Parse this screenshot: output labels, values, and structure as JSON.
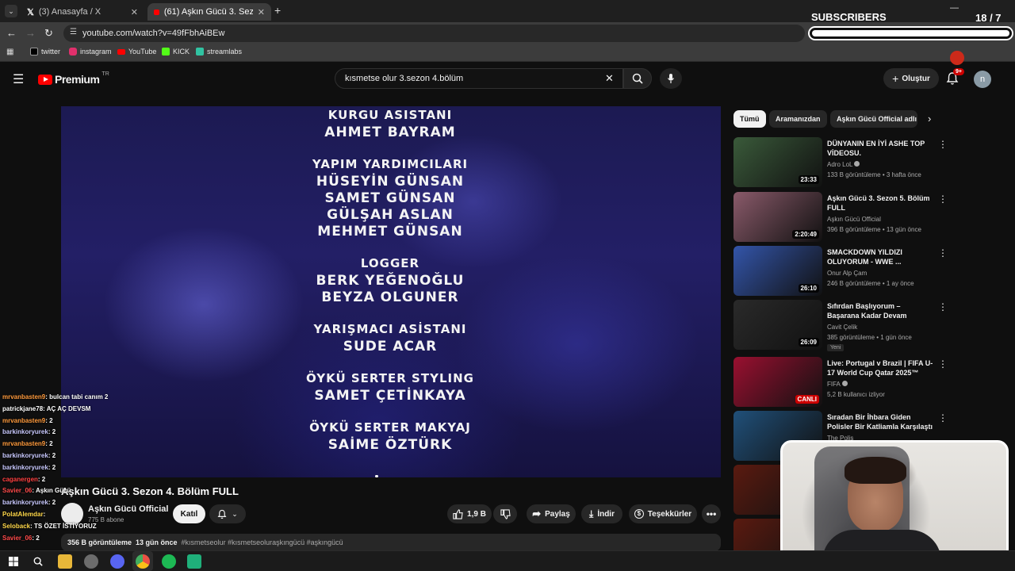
{
  "browser": {
    "tabs": [
      {
        "label": "(3) Anasayfa / X",
        "icon": "x-logo-icon",
        "active": false
      },
      {
        "label": "(61) Aşkın Gücü 3. Sezon 4. Bölü",
        "icon": "youtube-icon",
        "active": true
      }
    ],
    "url": "youtube.com/watch?v=49fFbhAiBEw",
    "bookmarks": [
      {
        "label": "twitter",
        "icon": "x-logo-icon",
        "color": "#ffffff"
      },
      {
        "label": "instagram",
        "icon": "instagram-icon",
        "color": "#e1306c"
      },
      {
        "label": "YouTube",
        "icon": "youtube-icon",
        "color": "#ff0000"
      },
      {
        "label": "KICK",
        "icon": "kick-icon",
        "color": "#53fc18"
      },
      {
        "label": "streamlabs",
        "icon": "streamlabs-icon",
        "color": "#31c3a2"
      }
    ]
  },
  "overlay": {
    "subscribers_label": "SUBSCRIBERS",
    "subscribers_count": "18 / 7",
    "subscribers_progress": 1.0
  },
  "youtube": {
    "logo": "Premium",
    "region": "TR",
    "search_query": "kısmetse olur 3.sezon 4.bölüm",
    "create_label": "Oluştur",
    "notif_badge": "9+",
    "avatar_letter": "n",
    "accent": "#ff0000"
  },
  "video": {
    "credits": [
      {
        "text": "KURGU ASISTANI",
        "kind": "role"
      },
      {
        "text": "AHMET BAYRAM",
        "kind": "name"
      },
      {
        "text": "YAPIM YARDIMCILARI",
        "kind": "role"
      },
      {
        "text": "HÜSEYİN GÜNSAN",
        "kind": "name"
      },
      {
        "text": "SAMET GÜNSAN",
        "kind": "name"
      },
      {
        "text": "GÜLŞAH ASLAN",
        "kind": "name"
      },
      {
        "text": "MEHMET GÜNSAN",
        "kind": "name"
      },
      {
        "text": "LOGGER",
        "kind": "role"
      },
      {
        "text": "BERK YEĞENOĞLU",
        "kind": "name"
      },
      {
        "text": "BEYZA OLGUNER",
        "kind": "name"
      },
      {
        "text": "YARIŞMACI ASİSTANI",
        "kind": "role"
      },
      {
        "text": "SUDE ACAR",
        "kind": "name"
      },
      {
        "text": "ÖYKÜ SERTER STYLING",
        "kind": "role"
      },
      {
        "text": "SAMET ÇETİNKAYA",
        "kind": "name"
      },
      {
        "text": "ÖYKÜ SERTER MAKYAJ",
        "kind": "role"
      },
      {
        "text": "SAİME ÖZTÜRK",
        "kind": "name"
      }
    ],
    "title": "Aşkın Gücü 3. Sezon 4. Bölüm FULL",
    "channel": "Aşkın Gücü Official",
    "subscribers": "775 B abone",
    "join_label": "Katıl",
    "likes": "1,9 B",
    "share_label": "Paylaş",
    "download_label": "İndir",
    "thanks_label": "Teşekkürler",
    "views": "356 B görüntüleme",
    "age": "13 gün önce",
    "hashtags": "#kısmetseolur #kısmetseoluraşkıngücü #aşkıngücü"
  },
  "sidebar": {
    "chips": [
      {
        "label": "Tümü",
        "active": true
      },
      {
        "label": "Aramanızdan",
        "active": false
      },
      {
        "label": "Aşkın Gücü Official adlı",
        "active": false
      }
    ],
    "recommendations": [
      {
        "title": "DÜNYANIN EN İYİ ASHE TOP VİDEOSU.",
        "channel": "Adro LoL",
        "verified": true,
        "meta": "133 B görüntüleme • 3 hafta önce",
        "duration": "23:33",
        "badge": "",
        "thumb_color": "#3a5a3a"
      },
      {
        "title": "Aşkın Gücü 3. Sezon 5. Bölüm FULL",
        "channel": "Aşkın Gücü Official",
        "verified": false,
        "meta": "396 B görüntüleme • 13 gün önce",
        "duration": "2:20:49",
        "badge": "",
        "thumb_color": "#8a5a6a"
      },
      {
        "title": "SMACKDOWN YILDIZI OLUYORUM - WWE ...",
        "channel": "Onur Alp Çam",
        "verified": false,
        "meta": "246 B görüntüleme • 1 ay önce",
        "duration": "26:10",
        "badge": "",
        "thumb_color": "#3355aa"
      },
      {
        "title": "Sıfırdan Başlıyorum – Başarana Kadar Devam",
        "channel": "Cavit Çelik",
        "verified": false,
        "meta": "385 görüntüleme • 1 gün önce",
        "duration": "26:09",
        "badge": "Yeni",
        "thumb_color": "#2a2a2a"
      },
      {
        "title": "Live: Portugal v Brazil | FIFA U-17 World Cup Qatar 2025™",
        "channel": "FIFA",
        "verified": true,
        "meta": "5,2 B kullanıcı izliyor",
        "duration": "CANLI",
        "badge": "",
        "thumb_color": "#9a1030"
      },
      {
        "title": "Sıradan Bir İhbara Giden Polisler Bir Katliamla Karşılaştı",
        "channel": "The Polis",
        "verified": false,
        "meta": "",
        "duration": "",
        "badge": "",
        "thumb_color": "#20507a"
      }
    ]
  },
  "chat": [
    {
      "user": "mrvanbasten9",
      "msg": ": bulcan tabi canım 2",
      "color": "#ff9a3c"
    },
    {
      "user": "patrickjane78",
      "msg": ": AÇ AÇ DEVSM",
      "color": "#ffffff"
    },
    {
      "user": "mrvanbasten9",
      "msg": ": 2",
      "color": "#ff9a3c"
    },
    {
      "user": "barkinkoryurek",
      "msg": ": 2",
      "color": "#c9c9ff"
    },
    {
      "user": "mrvanbasten9",
      "msg": ": 2",
      "color": "#ff9a3c"
    },
    {
      "user": "barkinkoryurek",
      "msg": ": 2",
      "color": "#c9c9ff"
    },
    {
      "user": "barkinkoryurek",
      "msg": ": 2",
      "color": "#c9c9ff"
    },
    {
      "user": "caganergen",
      "msg": ": 2",
      "color": "#ff4040"
    },
    {
      "user": "Savier_06",
      "msg": ": Aşkın Gücü",
      "color": "#ff4a4a"
    },
    {
      "user": "barkinkoryurek",
      "msg": ": 2",
      "color": "#c9c9ff"
    },
    {
      "user": "PolatAlemdar",
      "msg": ":",
      "color": "#ffd84a"
    },
    {
      "user": "Seloback",
      "msg": ": TS ÖZET İSTİYORUZ",
      "color": "#ffd84a"
    },
    {
      "user": "Savier_06",
      "msg": ": 2",
      "color": "#ff4a4a"
    }
  ]
}
